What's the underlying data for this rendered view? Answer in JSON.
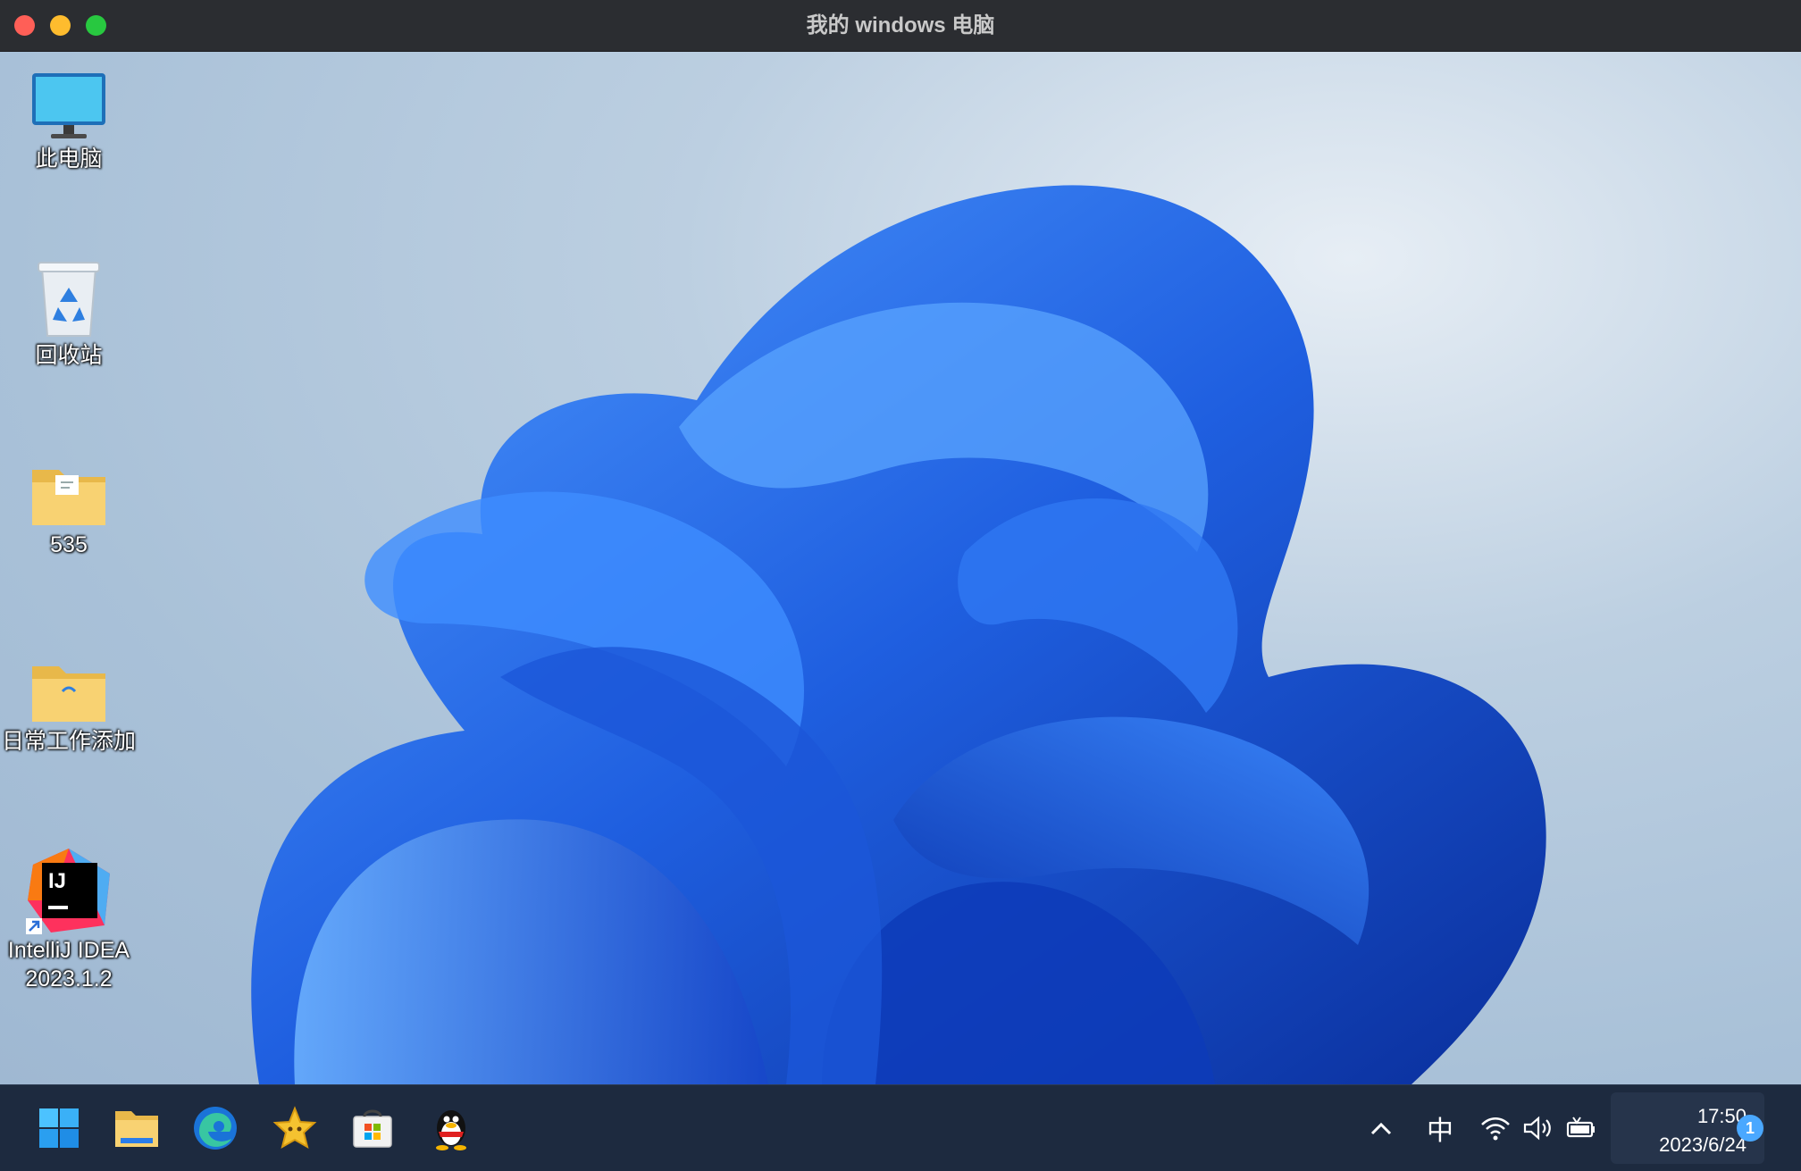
{
  "window": {
    "title": "我的 windows 电脑"
  },
  "desktop": {
    "icons": [
      {
        "label": "此电脑",
        "icon": "monitor-icon"
      },
      {
        "label": "回收站",
        "icon": "recycle-bin-icon"
      },
      {
        "label": "535",
        "icon": "folder-icon"
      },
      {
        "label": "日常工作添加",
        "icon": "folder-icon"
      },
      {
        "label_line1": "IntelliJ IDEA",
        "label_line2": "2023.1.2",
        "icon": "intellij-idea-icon"
      }
    ]
  },
  "taskbar": {
    "apps": [
      "windows-start-icon",
      "file-explorer-icon",
      "edge-icon",
      "star-app-icon",
      "microsoft-store-icon",
      "qq-icon"
    ],
    "tray": {
      "ime": "中",
      "time": "17:50",
      "date": "2023/6/24",
      "notification_count": "1"
    }
  },
  "colors": {
    "titlebar": "#2b2d31",
    "taskbar": "#1d2a3f",
    "accent": "#1f5fe0",
    "close": "#ff5f57",
    "minimize": "#febc2e",
    "maximize": "#28c840"
  }
}
